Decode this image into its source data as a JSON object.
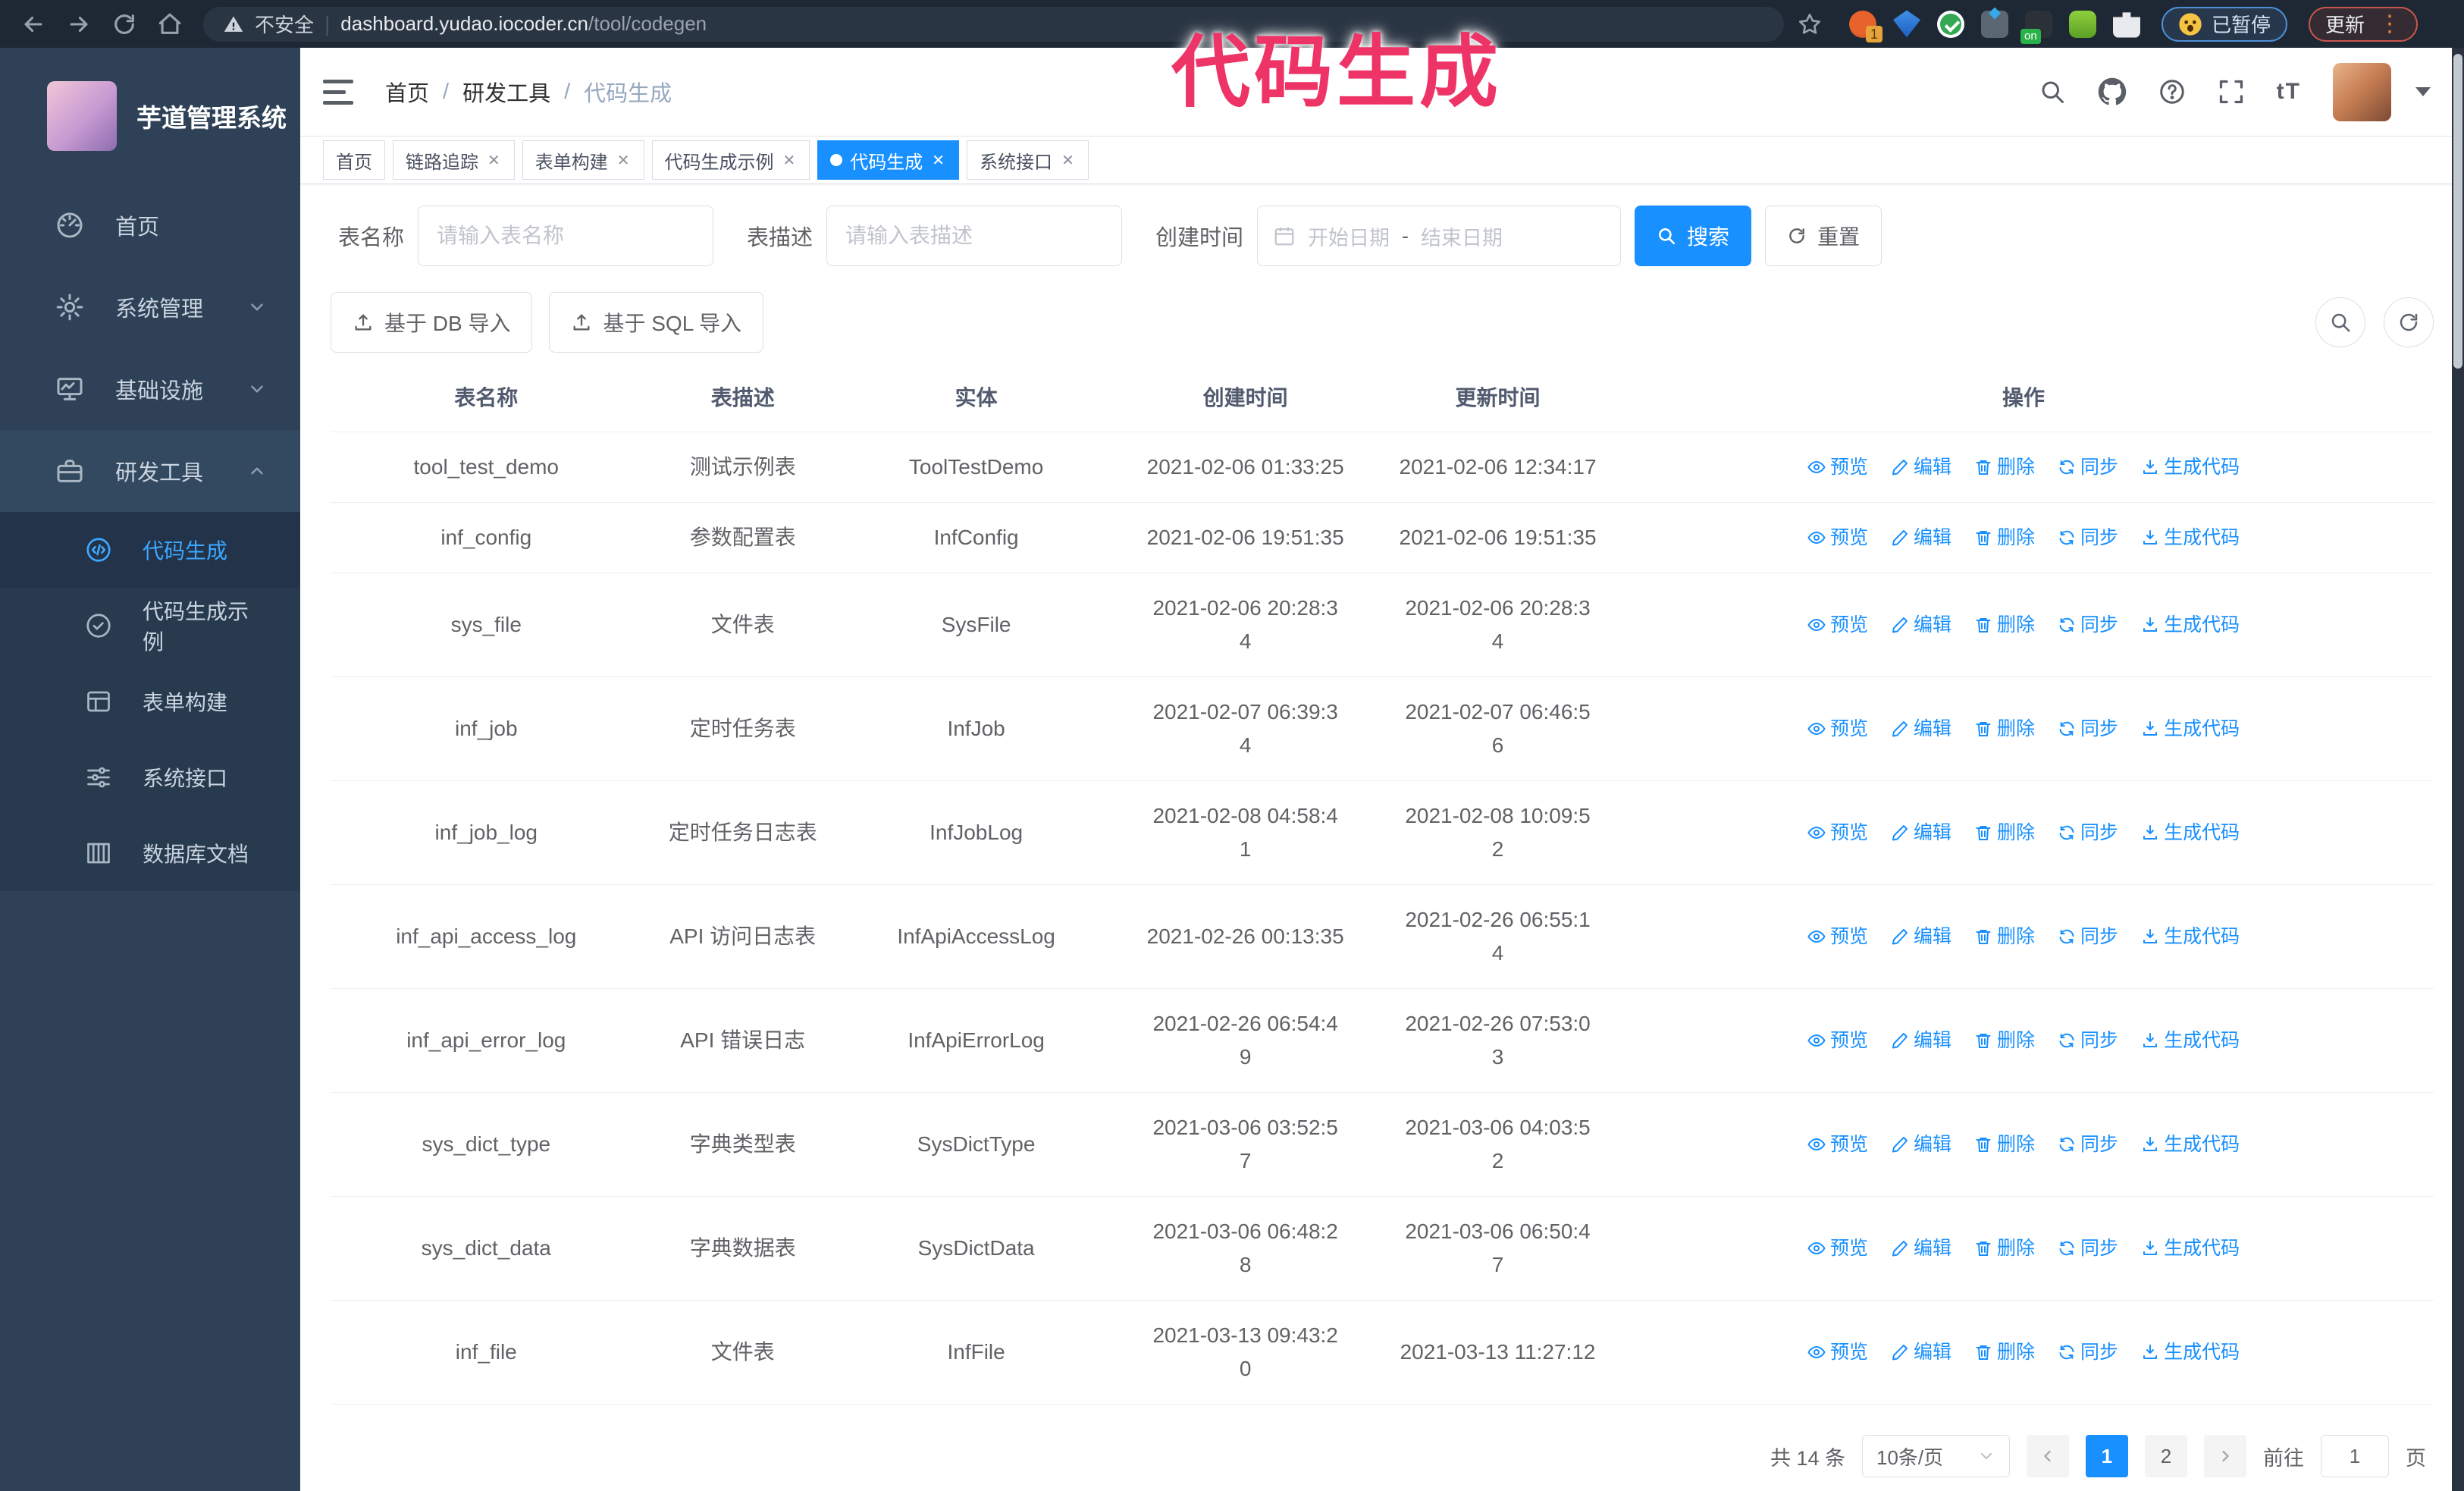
{
  "browser": {
    "security_label": "不安全",
    "url_host": "dashboard.yudao.iocoder.cn",
    "url_path": "/tool/codegen",
    "url_separator": "|",
    "paused_label": "已暂停",
    "update_label": "更新"
  },
  "annotation": "代码生成",
  "sidebar": {
    "title": "芋道管理系统",
    "items": [
      {
        "label": "首页"
      },
      {
        "label": "系统管理"
      },
      {
        "label": "基础设施"
      },
      {
        "label": "研发工具"
      }
    ],
    "submenu": [
      {
        "label": "代码生成",
        "active": true
      },
      {
        "label": "代码生成示例"
      },
      {
        "label": "表单构建"
      },
      {
        "label": "系统接口"
      },
      {
        "label": "数据库文档"
      }
    ]
  },
  "header": {
    "breadcrumb": [
      "首页",
      "研发工具",
      "代码生成"
    ]
  },
  "tags": [
    {
      "label": "首页",
      "closable": false,
      "active": false
    },
    {
      "label": "链路追踪",
      "closable": true,
      "active": false
    },
    {
      "label": "表单构建",
      "closable": true,
      "active": false
    },
    {
      "label": "代码生成示例",
      "closable": true,
      "active": false
    },
    {
      "label": "代码生成",
      "closable": true,
      "active": true
    },
    {
      "label": "系统接口",
      "closable": true,
      "active": false
    }
  ],
  "filters": {
    "name_label": "表名称",
    "name_placeholder": "请输入表名称",
    "desc_label": "表描述",
    "desc_placeholder": "请输入表描述",
    "time_label": "创建时间",
    "start_placeholder": "开始日期",
    "range_separator": "-",
    "end_placeholder": "结束日期",
    "search_label": "搜索",
    "reset_label": "重置"
  },
  "toolbar": {
    "import_db_label": "基于 DB 导入",
    "import_sql_label": "基于 SQL 导入"
  },
  "table": {
    "columns": [
      "表名称",
      "表描述",
      "实体",
      "创建时间",
      "更新时间",
      "操作"
    ],
    "actions": [
      {
        "label": "预览"
      },
      {
        "label": "编辑"
      },
      {
        "label": "删除"
      },
      {
        "label": "同步"
      },
      {
        "label": "生成代码"
      }
    ],
    "rows": [
      {
        "name": "tool_test_demo",
        "desc": "测试示例表",
        "entity": "ToolTestDemo",
        "created": [
          "2021-02-06 01:33:25"
        ],
        "updated": [
          "2021-02-06 12:34:17"
        ]
      },
      {
        "name": "inf_config",
        "desc": "参数配置表",
        "entity": "InfConfig",
        "created": [
          "2021-02-06 19:51:35"
        ],
        "updated": [
          "2021-02-06 19:51:35"
        ]
      },
      {
        "name": "sys_file",
        "desc": "文件表",
        "entity": "SysFile",
        "created": [
          "2021-02-06 20:28:3",
          "4"
        ],
        "updated": [
          "2021-02-06 20:28:3",
          "4"
        ]
      },
      {
        "name": "inf_job",
        "desc": "定时任务表",
        "entity": "InfJob",
        "created": [
          "2021-02-07 06:39:3",
          "4"
        ],
        "updated": [
          "2021-02-07 06:46:5",
          "6"
        ]
      },
      {
        "name": "inf_job_log",
        "desc": "定时任务日志表",
        "entity": "InfJobLog",
        "created": [
          "2021-02-08 04:58:4",
          "1"
        ],
        "updated": [
          "2021-02-08 10:09:5",
          "2"
        ]
      },
      {
        "name": "inf_api_access_log",
        "desc": "API 访问日志表",
        "entity": "InfApiAccessLog",
        "created": [
          "2021-02-26 00:13:35"
        ],
        "updated": [
          "2021-02-26 06:55:1",
          "4"
        ]
      },
      {
        "name": "inf_api_error_log",
        "desc": "API 错误日志",
        "entity": "InfApiErrorLog",
        "created": [
          "2021-02-26 06:54:4",
          "9"
        ],
        "updated": [
          "2021-02-26 07:53:0",
          "3"
        ]
      },
      {
        "name": "sys_dict_type",
        "desc": "字典类型表",
        "entity": "SysDictType",
        "created": [
          "2021-03-06 03:52:5",
          "7"
        ],
        "updated": [
          "2021-03-06 04:03:5",
          "2"
        ]
      },
      {
        "name": "sys_dict_data",
        "desc": "字典数据表",
        "entity": "SysDictData",
        "created": [
          "2021-03-06 06:48:2",
          "8"
        ],
        "updated": [
          "2021-03-06 06:50:4",
          "7"
        ]
      },
      {
        "name": "inf_file",
        "desc": "文件表",
        "entity": "InfFile",
        "created": [
          "2021-03-13 09:43:2",
          "0"
        ],
        "updated": [
          "2021-03-13 11:27:12"
        ]
      }
    ]
  },
  "pagination": {
    "total": "共 14 条",
    "page_size": "10条/页",
    "pages": [
      "1",
      "2"
    ],
    "goto_label": "前往",
    "goto_value": "1",
    "page_label": "页"
  },
  "colors": {
    "primary": "#1890ff",
    "annotation_pink": "#ee3467",
    "sidebar_bg": "#2e4156",
    "submenu_bg": "#283a4e",
    "browser_bg": "#1e2834"
  }
}
